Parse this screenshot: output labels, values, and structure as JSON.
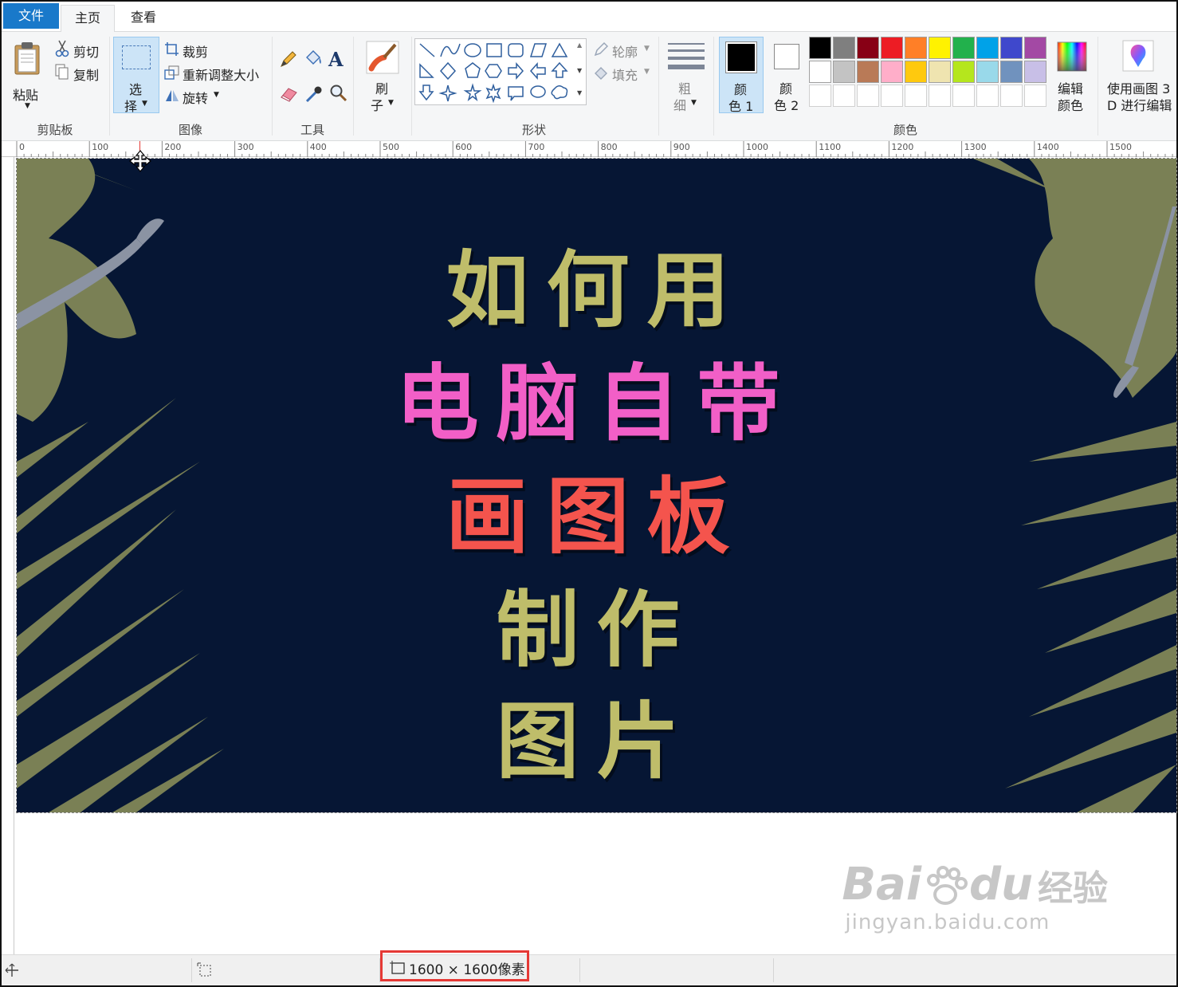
{
  "tabs": {
    "file": "文件",
    "home": "主页",
    "view": "查看"
  },
  "clipboard": {
    "paste": "粘贴",
    "cut": "剪切",
    "copy": "复制",
    "group": "剪贴板"
  },
  "image": {
    "select_top": "选",
    "select_bottom": "择",
    "crop": "裁剪",
    "resize": "重新调整大小",
    "rotate": "旋转",
    "group": "图像"
  },
  "tools": {
    "group": "工具",
    "text_glyph": "A"
  },
  "brush": {
    "top": "刷",
    "bottom": "子"
  },
  "shapes": {
    "outline": "轮廓",
    "fill": "填充",
    "group": "形状"
  },
  "size": {
    "top": "粗",
    "bottom": "细"
  },
  "colors": {
    "color1_top": "颜",
    "color1_bottom": "色 1",
    "color2_top": "颜",
    "color2_bottom": "色 2",
    "edit_top": "编辑",
    "edit_bottom": "颜色",
    "group": "颜色",
    "row1": [
      "#000000",
      "#7f7f7f",
      "#880015",
      "#ed1c24",
      "#ff7f27",
      "#fff200",
      "#22b14c",
      "#00a2e8",
      "#3f48cc",
      "#a349a4"
    ],
    "row2": [
      "#ffffff",
      "#c3c3c3",
      "#b97a57",
      "#ffaec9",
      "#ffc90e",
      "#efe4b0",
      "#b5e61d",
      "#99d9ea",
      "#7092be",
      "#c8bfe7"
    ]
  },
  "paint3d": {
    "top": "使用画图 3",
    "bottom": "D 进行编辑"
  },
  "ruler": [
    "0",
    "100",
    "200",
    "300",
    "400",
    "500",
    "600",
    "700",
    "800",
    "900",
    "1000",
    "1100",
    "1200",
    "1300",
    "1400",
    "1500"
  ],
  "canvas_text": {
    "line1": "如何用",
    "line2": "电脑自带",
    "line3": "画图板",
    "line4": "制作",
    "line5": "图片"
  },
  "canvas_colors": {
    "bg": "#061634",
    "olive": "#bfbd6a",
    "pink": "#f25fc7",
    "red": "#f4544d",
    "leaf": "#7a8055"
  },
  "status": {
    "image_size": "1600 × 1600像素"
  },
  "watermark": {
    "brand": "Bai",
    "brand2": "du",
    "cn": "经验",
    "url": "jingyan.baidu.com"
  }
}
